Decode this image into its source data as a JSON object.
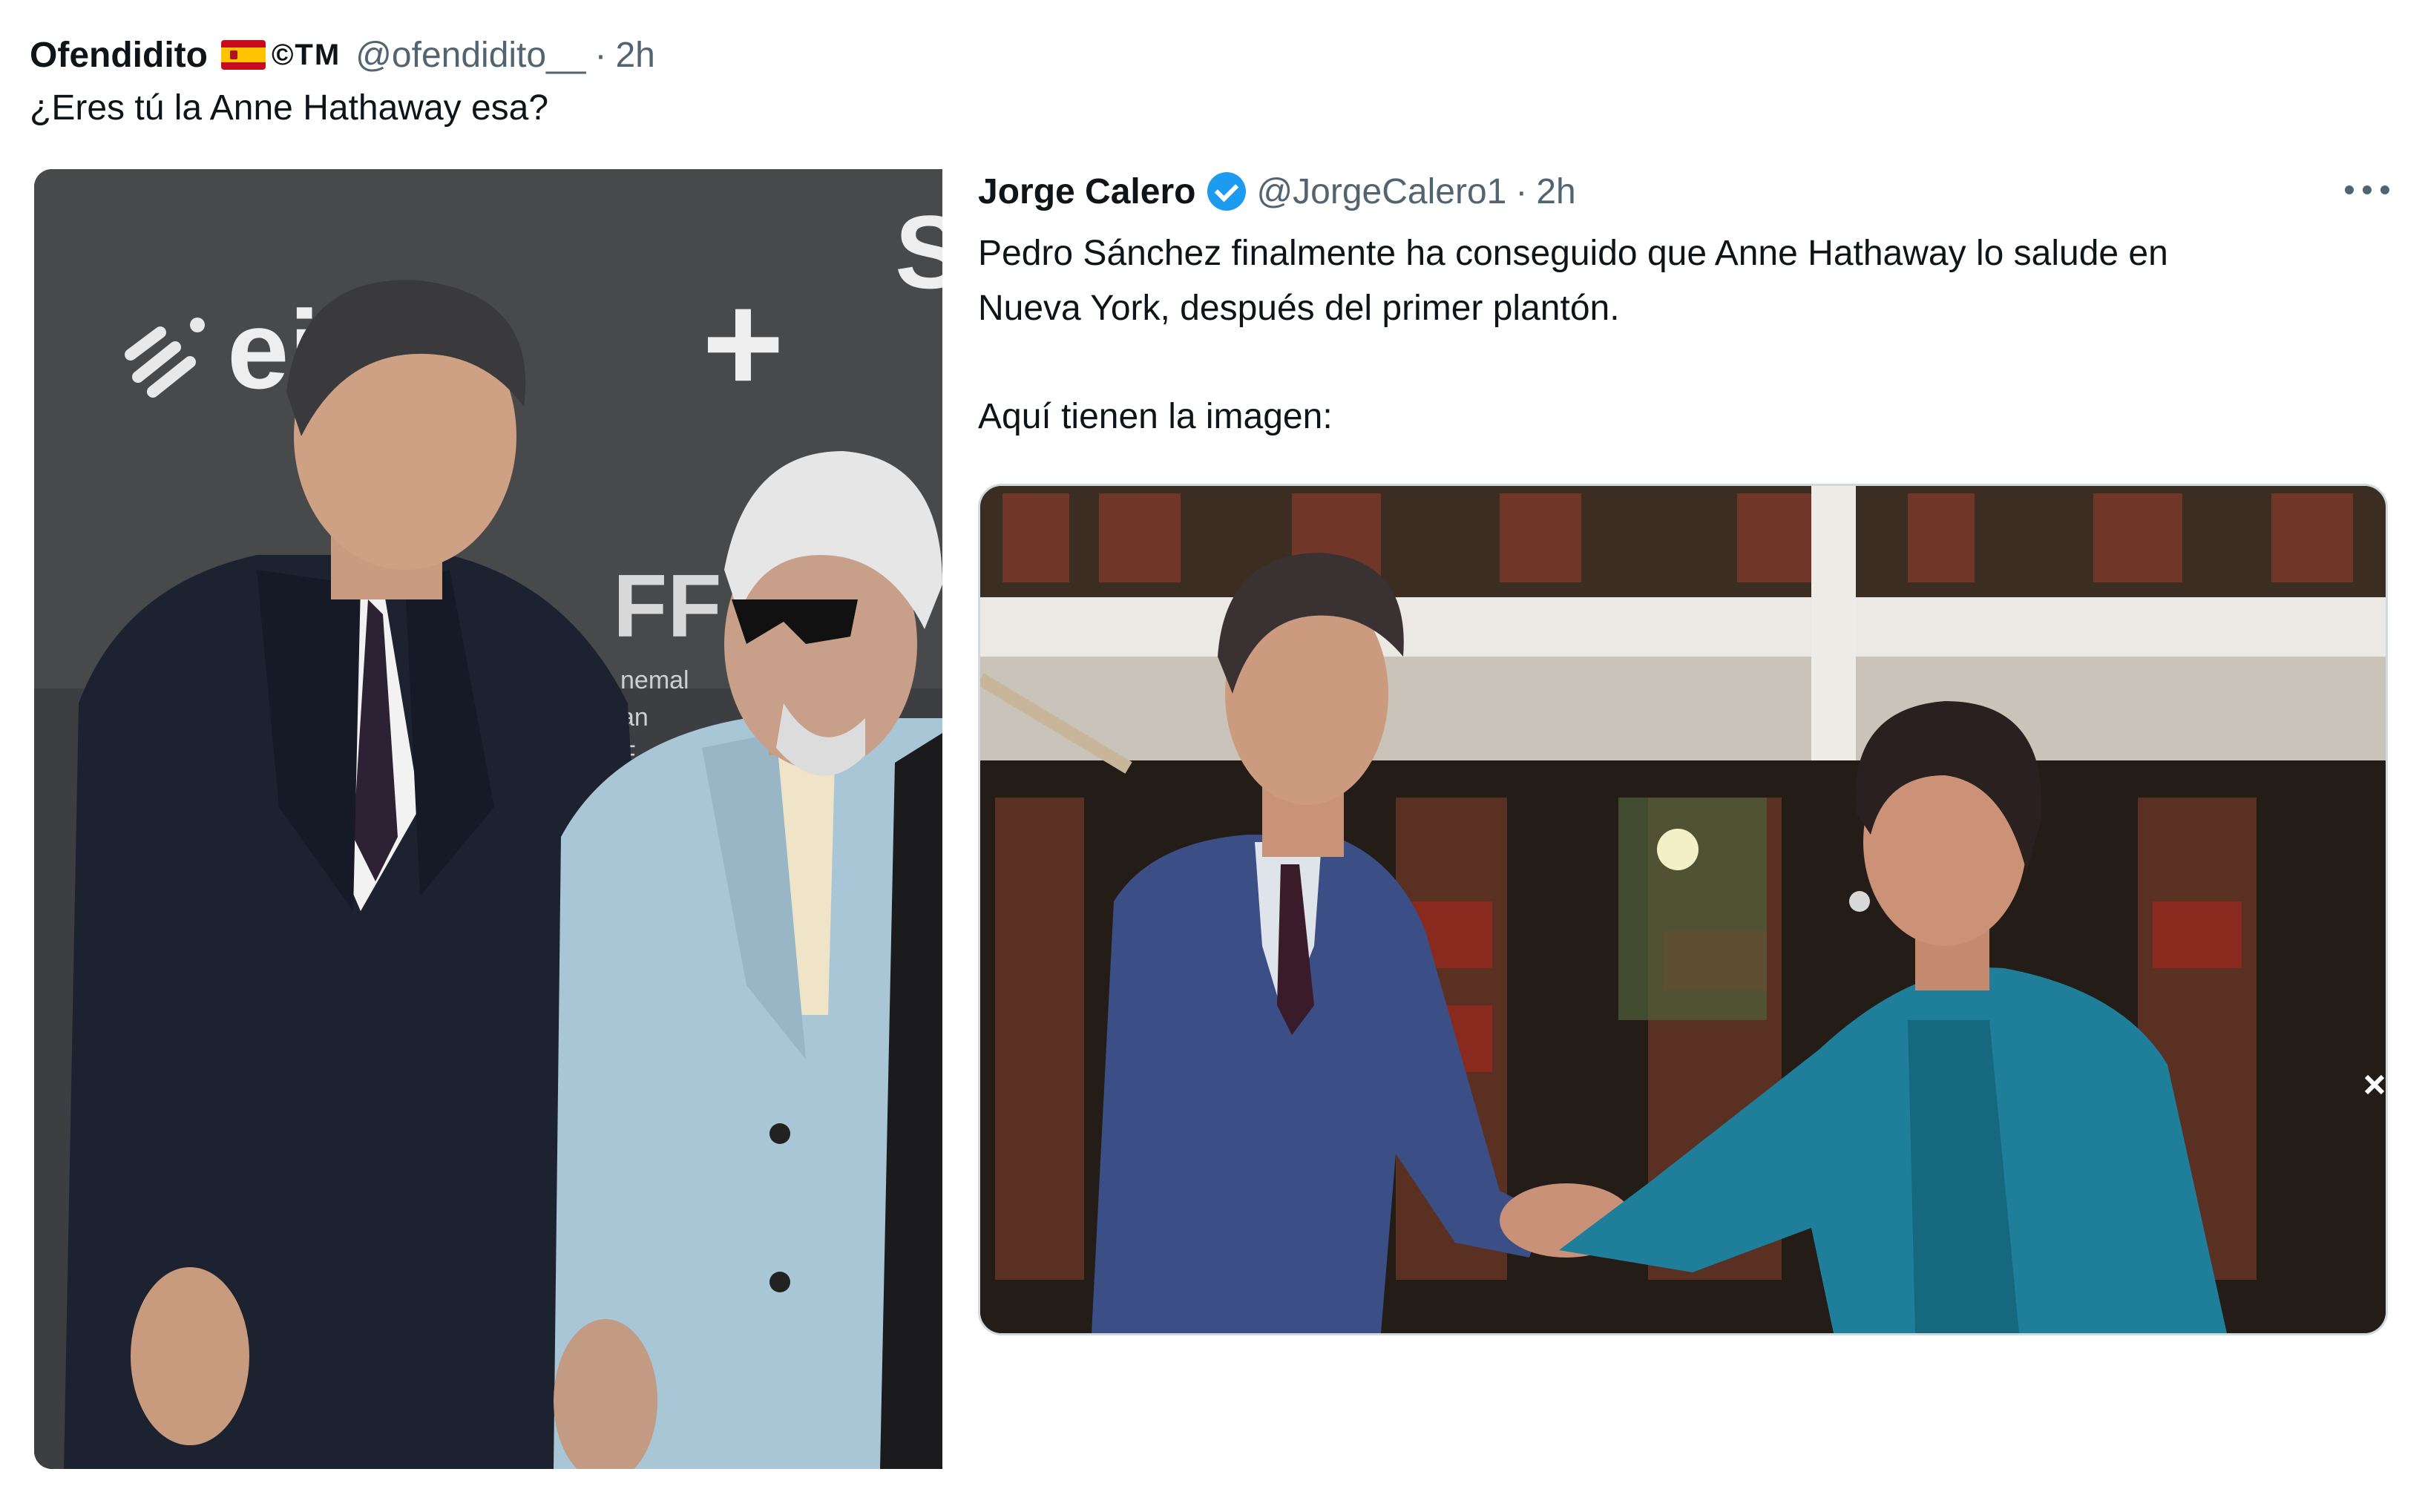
{
  "outer_tweet": {
    "author_name": "Ofendidito",
    "author_badge": "©TM",
    "flag_icon": "spain-flag-icon",
    "author_handle": "@ofendidito__",
    "separator": "·",
    "time": "2h",
    "text": "¿Eres tú la Anne Hathaway esa?"
  },
  "photo1": {
    "backdrop_logo": "eitb",
    "plus_sign": "+",
    "sign_text": "FF",
    "sign_small": [
      "nemal",
      "an",
      "F"
    ],
    "corner_letter": "S"
  },
  "quoted_tweet": {
    "author_name": "Jorge Calero",
    "verified_icon": "verified-badge-icon",
    "author_handle": "@JorgeCalero1",
    "separator": "·",
    "time": "2h",
    "more_icon": "more-options-icon",
    "text_line1": "Pedro Sánchez finalmente ha conseguido que Anne Hathaway lo salude en",
    "text_line2": "Nueva York, después del primer plantón.",
    "text_line3": "Aquí tienen la imagen:"
  },
  "colors": {
    "text_primary": "#0f1419",
    "text_secondary": "#536471",
    "verified_blue": "#1d9bf0",
    "border": "#cfd9de"
  }
}
